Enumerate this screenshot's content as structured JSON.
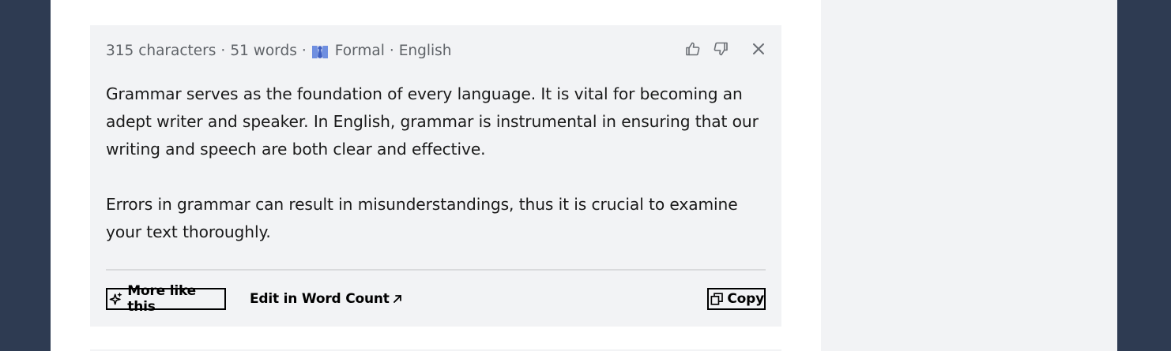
{
  "result": {
    "meta": {
      "characters": "315 characters",
      "words": "51 words",
      "tone": "Formal",
      "language": "English",
      "separator": "·",
      "tone_icon": "necktie-icon"
    },
    "actions": {
      "thumbs_up": "thumbs-up-icon",
      "thumbs_down": "thumbs-down-icon",
      "close": "close-icon"
    },
    "paragraphs": [
      "Grammar serves as the foundation of every language. It is vital for becoming an adept writer and speaker. In English, grammar is instrumental in ensuring that our writing and speech are both clear and effective.",
      "Errors in grammar can result in misunderstandings, thus it is crucial to examine your text thoroughly."
    ],
    "footer": {
      "more_like_this": "More like this",
      "edit_in_word_count": "Edit in Word Count",
      "copy": "Copy"
    }
  },
  "colors": {
    "background": "#2e3b52",
    "card": "#f2f3f5",
    "tie": "#5b7fd6"
  }
}
